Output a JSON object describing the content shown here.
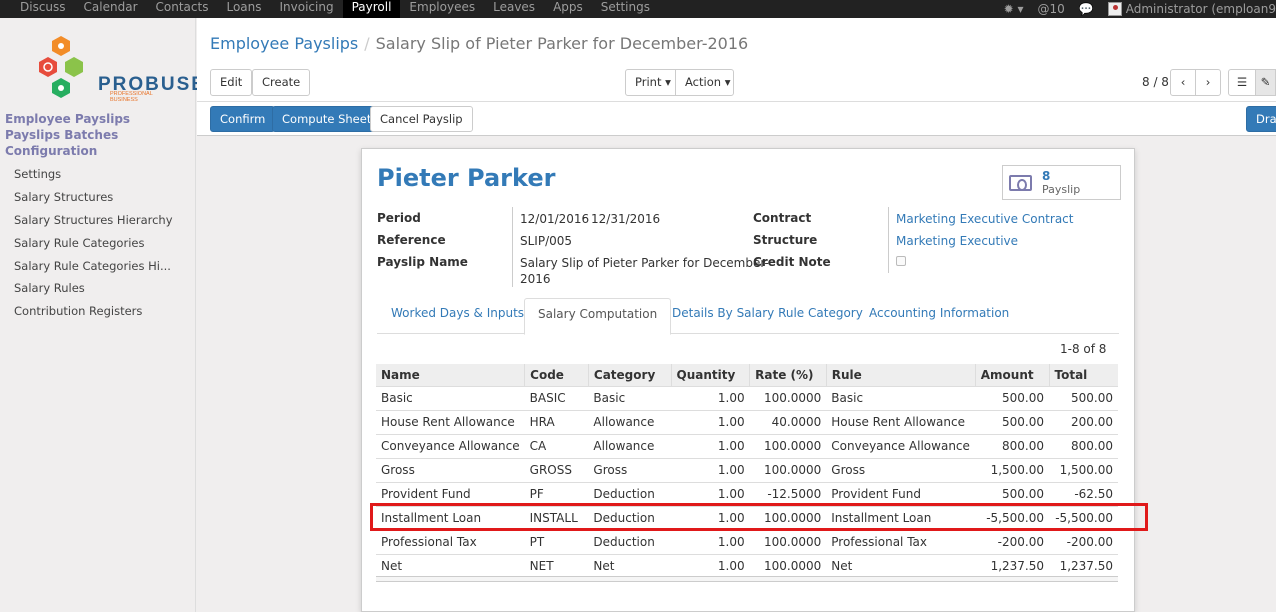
{
  "topnav": {
    "menus": [
      "Discuss",
      "Calendar",
      "Contacts",
      "Loans",
      "Invoicing",
      "Payroll",
      "Employees",
      "Leaves",
      "Apps",
      "Settings"
    ],
    "active": "Payroll",
    "messages_count": "10",
    "user": "Administrator (emploan9"
  },
  "logo": {
    "name": "PROBUSE",
    "tagline": "PROFESSIONAL BUSINESS"
  },
  "sidebar": {
    "headings": [
      "Employee Payslips",
      "Payslips Batches",
      "Configuration"
    ],
    "items": [
      "Settings",
      "Salary Structures",
      "Salary Structures Hierarchy",
      "Salary Rule Categories",
      "Salary Rule Categories Hi...",
      "Salary Rules",
      "Contribution Registers"
    ]
  },
  "breadcrumb": {
    "parent": "Employee Payslips",
    "separator": "/",
    "current": "Salary Slip of Pieter Parker for December-2016"
  },
  "buttons": {
    "edit": "Edit",
    "create": "Create",
    "print": "Print",
    "action": "Action",
    "confirm": "Confirm",
    "compute": "Compute Sheet",
    "cancel": "Cancel Payslip",
    "draft": "Dra"
  },
  "pager": "8 / 8",
  "sheet": {
    "employee": "Pieter Parker",
    "smart_button": {
      "count": "8",
      "label": "Payslip"
    },
    "fields": {
      "period_label": "Period",
      "period_from": "12/01/2016",
      "period_sep": "-",
      "period_to": "12/31/2016",
      "reference_label": "Reference",
      "reference": "SLIP/005",
      "payslip_name_label": "Payslip Name",
      "payslip_name_1": "Salary Slip of Pieter Parker for December-",
      "payslip_name_2": "2016",
      "contract_label": "Contract",
      "contract": "Marketing Executive Contract",
      "structure_label": "Structure",
      "structure": "Marketing Executive",
      "credit_note_label": "Credit Note"
    },
    "tabs": [
      "Worked Days & Inputs",
      "Salary Computation",
      "Details By Salary Rule Category",
      "Accounting Information"
    ],
    "active_tab": "Salary Computation",
    "record_count": "1-8 of 8",
    "columns": [
      "Name",
      "Code",
      "Category",
      "Quantity",
      "Rate (%)",
      "Rule",
      "Amount",
      "Total"
    ],
    "rows": [
      [
        "Basic",
        "BASIC",
        "Basic",
        "1.00",
        "100.0000",
        "Basic",
        "500.00",
        "500.00"
      ],
      [
        "House Rent Allowance",
        "HRA",
        "Allowance",
        "1.00",
        "40.0000",
        "House Rent Allowance",
        "500.00",
        "200.00"
      ],
      [
        "Conveyance Allowance",
        "CA",
        "Allowance",
        "1.00",
        "100.0000",
        "Conveyance Allowance",
        "800.00",
        "800.00"
      ],
      [
        "Gross",
        "GROSS",
        "Gross",
        "1.00",
        "100.0000",
        "Gross",
        "1,500.00",
        "1,500.00"
      ],
      [
        "Provident Fund",
        "PF",
        "Deduction",
        "1.00",
        "-12.5000",
        "Provident Fund",
        "500.00",
        "-62.50"
      ],
      [
        "Installment Loan",
        "INSTALL",
        "Deduction",
        "1.00",
        "100.0000",
        "Installment Loan",
        "-5,500.00",
        "-5,500.00"
      ],
      [
        "Professional Tax",
        "PT",
        "Deduction",
        "1.00",
        "100.0000",
        "Professional Tax",
        "-200.00",
        "-200.00"
      ],
      [
        "Net",
        "NET",
        "Net",
        "1.00",
        "100.0000",
        "Net",
        "1,237.50",
        "1,237.50"
      ]
    ]
  },
  "colors": {
    "primary": "#337ab7",
    "sidebar_heading": "#7c7bad",
    "highlight": "#e0191a"
  }
}
